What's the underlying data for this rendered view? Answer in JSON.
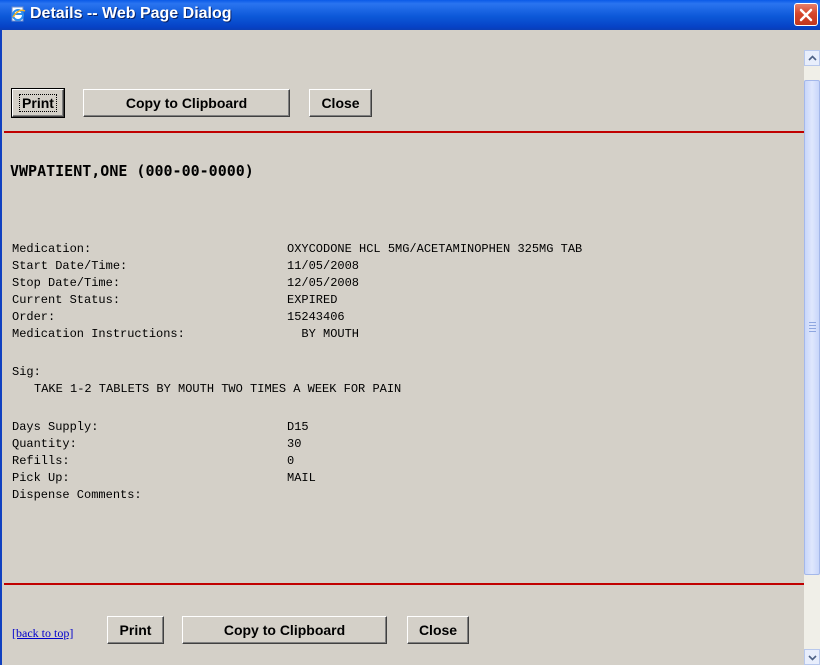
{
  "window": {
    "title": "Details -- Web Page Dialog",
    "icon": "ie-page-icon",
    "close_icon": "close-icon"
  },
  "toolbar_top": {
    "print_label": "Print",
    "copy_label": "Copy to Clipboard",
    "close_label": "Close"
  },
  "patient": {
    "header": "VWPATIENT,ONE (000-00-0000)"
  },
  "details": {
    "medication": {
      "label": "Medication:",
      "value": "OXYCODONE HCL 5MG/ACETAMINOPHEN 325MG TAB"
    },
    "start": {
      "label": "Start Date/Time:",
      "value": "11/05/2008"
    },
    "stop": {
      "label": "Stop Date/Time:",
      "value": "12/05/2008"
    },
    "status": {
      "label": "Current Status:",
      "value": "EXPIRED"
    },
    "order": {
      "label": "Order:",
      "value": "15243406"
    },
    "instructions": {
      "label": "Medication Instructions:",
      "value": "  BY MOUTH"
    },
    "sig_label": "Sig:",
    "sig_text": "TAKE 1-2 TABLETS BY MOUTH TWO TIMES A WEEK FOR PAIN",
    "days_supply": {
      "label": "Days Supply:",
      "value": "D15"
    },
    "quantity": {
      "label": "Quantity:",
      "value": "30"
    },
    "refills": {
      "label": "Refills:",
      "value": "0"
    },
    "pickup": {
      "label": "Pick Up:",
      "value": "MAIL"
    },
    "dispense_comments": {
      "label": "Dispense Comments:",
      "value": ""
    }
  },
  "toolbar_bottom": {
    "back_to_top": "[back to top]",
    "print_label": "Print",
    "copy_label": "Copy to Clipboard",
    "close_label": "Close"
  },
  "colors": {
    "titlebar": "#0a5ae8",
    "separator": "#c00000",
    "background": "#d4d0c8",
    "link": "#0000cc"
  }
}
